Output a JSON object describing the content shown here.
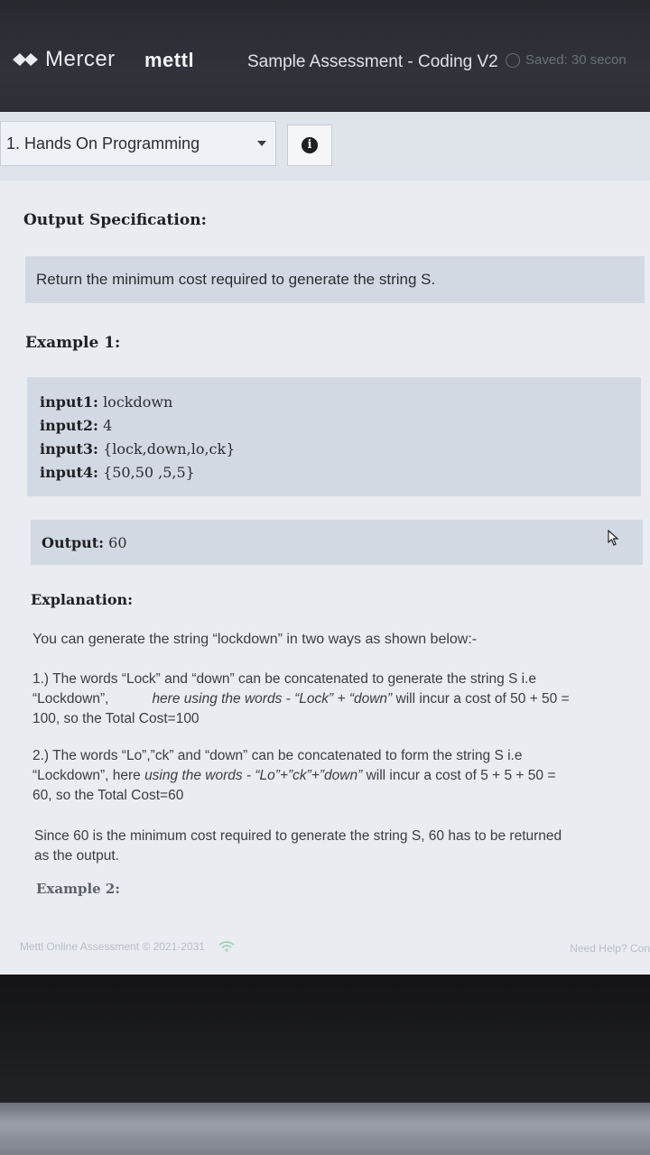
{
  "header": {
    "brand": "Mercer",
    "product": "mettl",
    "assessment_title": "Sample Assessment - Coding V2",
    "saved_status": "Saved: 30 secon"
  },
  "section_select": {
    "value": "1. Hands On Programming"
  },
  "content": {
    "output_spec_heading": "Output Specification:",
    "output_spec_text": "Return the minimum cost required to generate the string S.",
    "example1_heading": "Example 1:",
    "inputs": [
      {
        "label": "input1:",
        "value": "lockdown"
      },
      {
        "label": "input2:",
        "value": "4"
      },
      {
        "label": "input3:",
        "value": "{lock,down,lo,ck}"
      },
      {
        "label": "input4:",
        "value": "{50,50 ,5,5}"
      }
    ],
    "output_label": "Output:",
    "output_value": "60",
    "explanation_heading": "Explanation:",
    "explanation_intro": "You can generate the string  “lockdown” in two ways as shown below:-",
    "way1": {
      "line1": "1.) The words “Lock” and “down” can be concatenated to generate the string S i.e",
      "line2a": "“Lockdown”,",
      "line2b_italic": "here using the words - “Lock” + “down”",
      "line2c": " will incur a cost of 50 + 50 =",
      "line3": "100, so the Total Cost=100"
    },
    "way2": {
      "line1": "2.) The words “Lo”,”ck” and “down” can be concatenated to form the string S i.e",
      "line2a": "“Lockdown”, here ",
      "line2b_italic": "using the words - “Lo”+”ck”+”down”",
      "line2c": " will incur a cost of 5 + 5 + 50 =",
      "line3": "60, so the Total Cost=60"
    },
    "conclusion_line1": "Since 60 is the minimum cost required to generate the string S, 60 has to be returned",
    "conclusion_line2": "as the output.",
    "example2_heading": "Example 2:"
  },
  "footer": {
    "copyright": "Mettl Online Assessment © 2021-2031",
    "help": "Need Help? Con"
  }
}
